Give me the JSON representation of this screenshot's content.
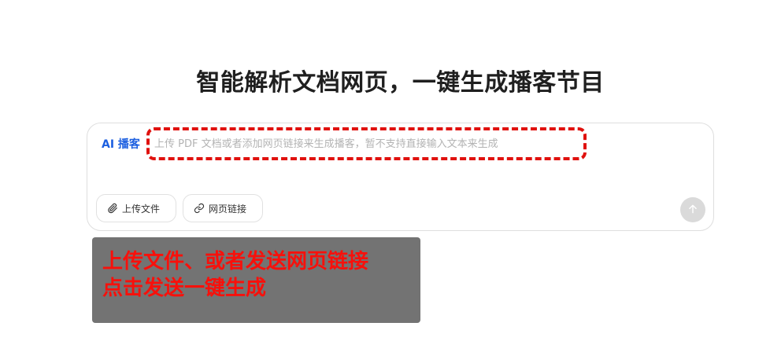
{
  "header": {
    "title": "智能解析文档网页，一键生成播客节目"
  },
  "composer": {
    "badge": "AI 播客",
    "placeholder": "上传 PDF 文档或者添加网页链接来生成播客，暂不支持直接输入文本来生成",
    "upload_button": {
      "label": "上传文件",
      "icon": "paperclip-icon"
    },
    "link_button": {
      "label": "网页链接",
      "icon": "link-icon"
    },
    "send_button": {
      "icon": "arrow-up-icon"
    }
  },
  "annotation": {
    "line1": "上传文件、或者发送网页链接",
    "line2": "点击发送一键生成",
    "highlight_color": "#e0110e"
  }
}
